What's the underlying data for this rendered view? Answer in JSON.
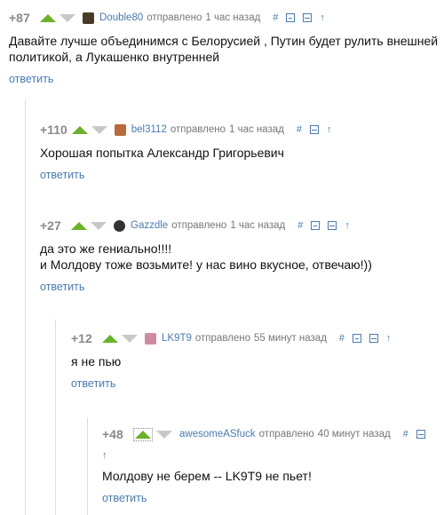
{
  "comments": [
    {
      "rating": "+87",
      "author": "Double80",
      "posted_label": "отправлено",
      "time": "1 час назад",
      "text_lines": [
        "Давайте лучше объединимся с Белорусией , Путин будет рулить внешней",
        "политикой, а Лукашенко внутренней"
      ],
      "reply_label": "ответить",
      "avatar_color": "#4a3a2a"
    },
    {
      "rating": "+110",
      "author": "bel3112",
      "posted_label": "отправлено",
      "time": "1 час назад",
      "text_lines": [
        "Хорошая попытка Александр Григорьевич"
      ],
      "reply_label": "ответить",
      "avatar_color": "#b86a3a"
    },
    {
      "rating": "+27",
      "author": "Gazzdle",
      "posted_label": "отправлено",
      "time": "1 час назад",
      "text_lines": [
        "да это же гениально!!!!",
        "и Молдову тоже возьмите! у нас вино вкусное, отвечаю!))"
      ],
      "reply_label": "ответить",
      "avatar_color": "#333333"
    },
    {
      "rating": "+12",
      "author": "LK9T9",
      "posted_label": "отправлено",
      "time": "55 минут назад",
      "text_lines": [
        "я не пью"
      ],
      "reply_label": "ответить",
      "avatar_color": "#d08aa0"
    },
    {
      "rating": "+48",
      "author": "awesomeASfuck",
      "posted_label": "отправлено",
      "time": "40 минут назад",
      "text_lines": [
        "Молдову не берем -- LK9T9 не пьет!"
      ],
      "reply_label": "ответить"
    }
  ],
  "icons": {
    "hash": "#",
    "arrow_up": "↑"
  },
  "colors": {
    "vote_up": "#6ab22a",
    "vote_down": "#c8c8c8",
    "link": "#4a7bb0"
  }
}
